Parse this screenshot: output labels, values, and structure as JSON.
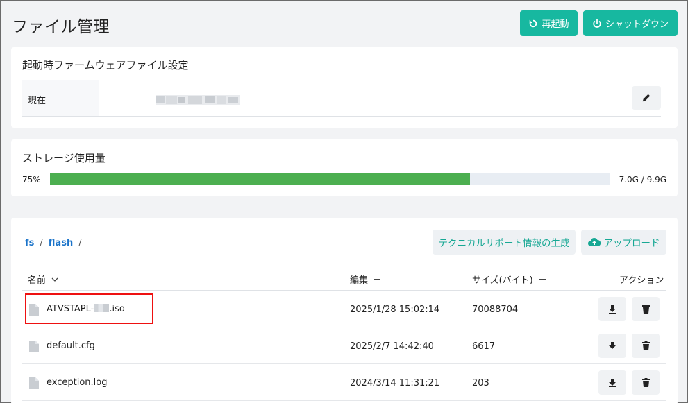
{
  "header": {
    "title": "ファイル管理",
    "restart_label": "再起動",
    "shutdown_label": "シャットダウン"
  },
  "firmware": {
    "title": "起動時ファームウェアファイル設定",
    "current_label": "現在"
  },
  "storage": {
    "title": "ストレージ使用量",
    "percent_label": "75%",
    "percent_value": 75,
    "usage_label": "7.0G / 9.9G",
    "bar_color": "#4caf50"
  },
  "files": {
    "breadcrumb": [
      "fs",
      "flash"
    ],
    "breadcrumb_sep": "/",
    "tech_support_label": "テクニカルサポート情報の生成",
    "upload_label": "アップロード",
    "columns": {
      "name": "名前",
      "modified": "編集",
      "size": "サイズ(バイト)",
      "actions": "アクション"
    },
    "rows": [
      {
        "name_prefix": "ATVSTAPL-",
        "name_suffix": ".iso",
        "date": "2025/1/28 15:02:14",
        "size": "70088704"
      },
      {
        "name": "default.cfg",
        "date": "2025/2/7 14:42:40",
        "size": "6617"
      },
      {
        "name": "exception.log",
        "date": "2024/3/14 11:31:21",
        "size": "203"
      }
    ]
  },
  "colors": {
    "accent": "#17b8a0",
    "link": "#1a73c9",
    "highlight": "#ee1111"
  }
}
